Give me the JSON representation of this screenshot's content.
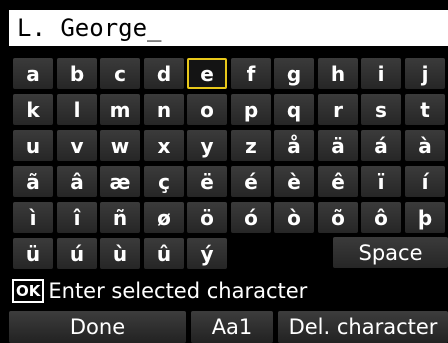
{
  "input": {
    "value": "L. George",
    "cursor": "_"
  },
  "keyboard": {
    "selected": "e",
    "rows": [
      [
        "a",
        "b",
        "c",
        "d",
        "e",
        "f",
        "g",
        "h",
        "i",
        "j"
      ],
      [
        "k",
        "l",
        "m",
        "n",
        "o",
        "p",
        "q",
        "r",
        "s",
        "t"
      ],
      [
        "u",
        "v",
        "w",
        "x",
        "y",
        "z",
        "å",
        "ä",
        "á",
        "à"
      ],
      [
        "ã",
        "â",
        "æ",
        "ç",
        "ë",
        "é",
        "è",
        "ê",
        "ï",
        "í"
      ],
      [
        "ì",
        "î",
        "ñ",
        "ø",
        "ö",
        "ó",
        "ò",
        "õ",
        "ô",
        "þ"
      ],
      [
        "ü",
        "ú",
        "ù",
        "û",
        "ý"
      ]
    ],
    "space_label": "Space"
  },
  "hint": {
    "ok_label": "OK",
    "text": "Enter selected character"
  },
  "buttons": {
    "done": "Done",
    "case": "Aa1",
    "delete": "Del. character"
  },
  "colors": {
    "selection_border": "#e8c81a",
    "background": "#000000",
    "input_bg": "#ffffff"
  }
}
